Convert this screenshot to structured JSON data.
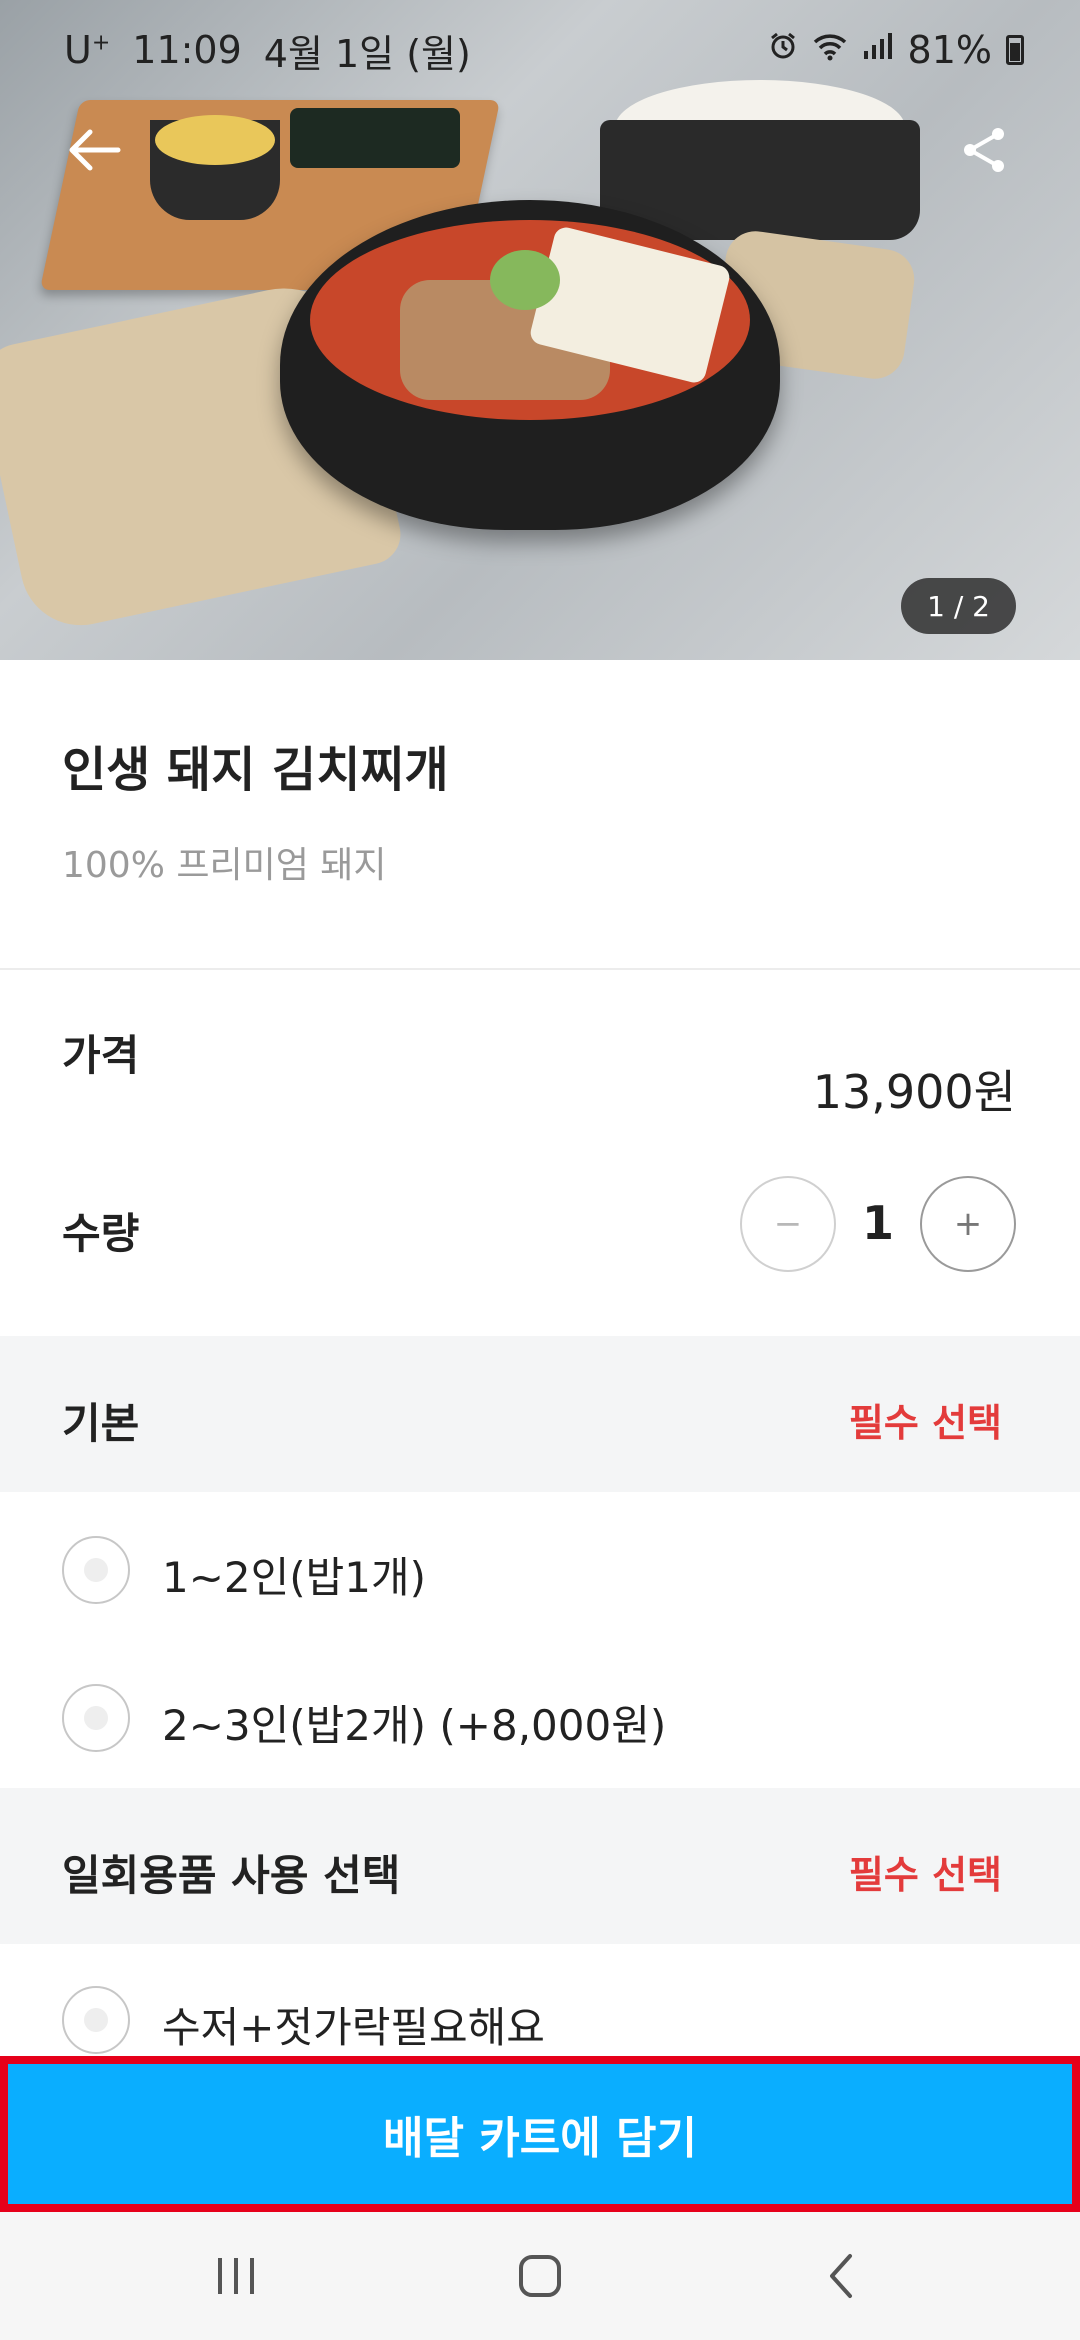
{
  "status_bar": {
    "carrier": "U",
    "carrier_sup": "+",
    "time": "11:09",
    "date": "4월 1일 (월)",
    "battery": "81%",
    "icons": [
      "alarm-icon",
      "wifi-icon",
      "signal-icon",
      "battery-icon"
    ]
  },
  "hero": {
    "pager": "1 / 2"
  },
  "product": {
    "title": "인생 돼지 김치찌개",
    "subtitle": "100% 프리미엄 돼지"
  },
  "price": {
    "label": "가격",
    "value": "13,900원"
  },
  "quantity": {
    "label": "수량",
    "minus": "−",
    "value": "1",
    "plus": "+"
  },
  "option_groups": [
    {
      "title": "기본",
      "required_label": "필수 선택",
      "options": [
        {
          "label": "1~2인(밥1개)"
        },
        {
          "label": "2~3인(밥2개) (+8,000원)"
        }
      ]
    },
    {
      "title": "일회용품 사용 선택",
      "required_label": "필수 선택",
      "options": [
        {
          "label": "수저+젓가락필요해요"
        }
      ]
    }
  ],
  "cta": {
    "label": "배달 카트에 담기"
  },
  "colors": {
    "accent": "#0aaeff",
    "required": "#e33b3b",
    "highlight_border": "#e6001a"
  }
}
